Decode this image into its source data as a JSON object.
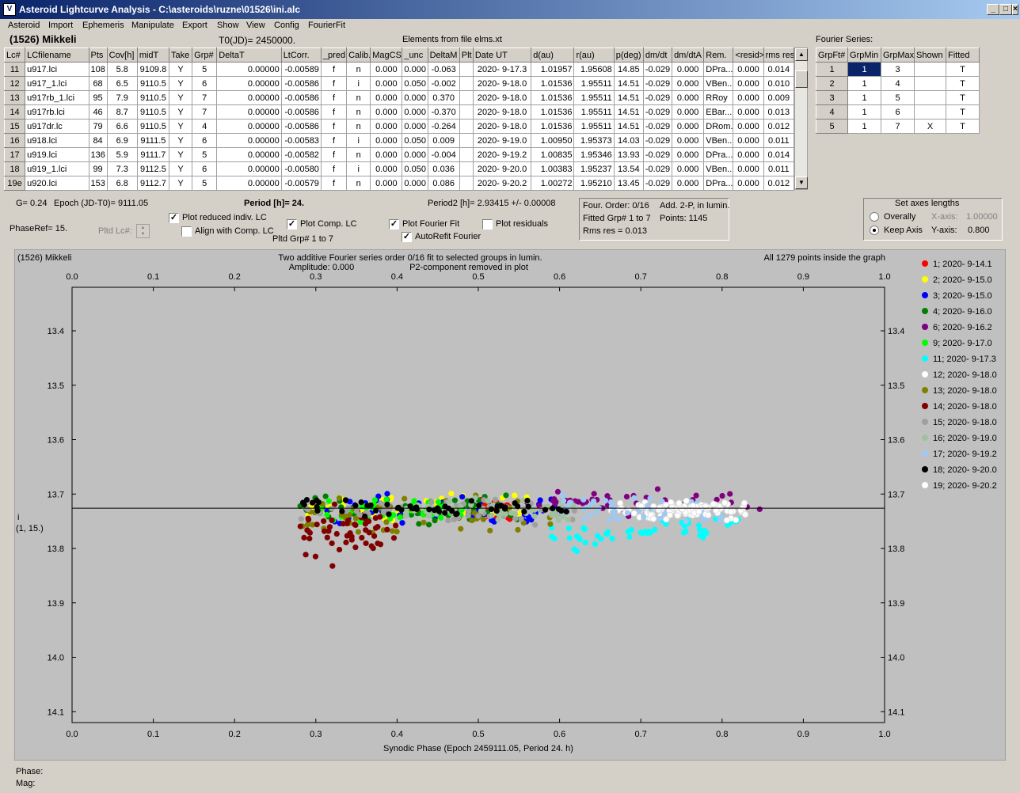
{
  "window": {
    "title": "Asteroid Lightcurve Analysis - C:\\asteroids\\ruzne\\01526\\ini.alc",
    "app_icon": "V"
  },
  "menu": [
    "Asteroid",
    "Import",
    "Ephemeris",
    "Manipulate",
    "Export",
    "Show",
    "View",
    "Config",
    "FourierFit"
  ],
  "asteroid_name": "(1526) Mikkeli",
  "t0": "T0(JD)= 2450000.",
  "elements": "Elements from file elms.xt",
  "lc_table": {
    "headers": [
      "Lc#",
      "LCfilename",
      "Pts",
      "Cov[h]",
      "midT",
      "Take",
      "Grp#",
      "DeltaT",
      "LtCorr.",
      "_pred.",
      "Calib.",
      "MagCS",
      "_unc",
      "DeltaM",
      "Plt",
      "Date UT",
      "d(au)",
      "r(au)",
      "p(deg)",
      "dm/dt",
      "dm/dtA",
      "Rem.",
      "<resid>",
      "rms res"
    ],
    "rows": [
      [
        "11",
        "u917.lci",
        "108",
        "5.8",
        "9109.8",
        "Y",
        "5",
        "0.00000",
        "-0.00589",
        "f",
        "n",
        "0.000",
        "0.000",
        "-0.063",
        "",
        "2020- 9-17.3",
        "1.01957",
        "1.95608",
        "14.85",
        "-0.029",
        "0.000",
        "DPra...",
        "0.000",
        "0.014"
      ],
      [
        "12",
        "u917_1.lci",
        "68",
        "6.5",
        "9110.5",
        "Y",
        "6",
        "0.00000",
        "-0.00586",
        "f",
        "i",
        "0.000",
        "0.050",
        "-0.002",
        "",
        "2020- 9-18.0",
        "1.01536",
        "1.95511",
        "14.51",
        "-0.029",
        "0.000",
        "VBen...",
        "0.000",
        "0.010"
      ],
      [
        "13",
        "u917rb_1.lci",
        "95",
        "7.9",
        "9110.5",
        "Y",
        "7",
        "0.00000",
        "-0.00586",
        "f",
        "n",
        "0.000",
        "0.000",
        "0.370",
        "",
        "2020- 9-18.0",
        "1.01536",
        "1.95511",
        "14.51",
        "-0.029",
        "0.000",
        "RRoy",
        "0.000",
        "0.009"
      ],
      [
        "14",
        "u917rb.lci",
        "46",
        "8.7",
        "9110.5",
        "Y",
        "7",
        "0.00000",
        "-0.00586",
        "f",
        "n",
        "0.000",
        "0.000",
        "-0.370",
        "",
        "2020- 9-18.0",
        "1.01536",
        "1.95511",
        "14.51",
        "-0.029",
        "0.000",
        "EBar...",
        "0.000",
        "0.013"
      ],
      [
        "15",
        "u917dr.lc",
        "79",
        "6.6",
        "9110.5",
        "Y",
        "4",
        "0.00000",
        "-0.00586",
        "f",
        "n",
        "0.000",
        "0.000",
        "-0.264",
        "",
        "2020- 9-18.0",
        "1.01536",
        "1.95511",
        "14.51",
        "-0.029",
        "0.000",
        "DRom...",
        "0.000",
        "0.012"
      ],
      [
        "16",
        "u918.lci",
        "84",
        "6.9",
        "9111.5",
        "Y",
        "6",
        "0.00000",
        "-0.00583",
        "f",
        "i",
        "0.000",
        "0.050",
        "0.009",
        "",
        "2020- 9-19.0",
        "1.00950",
        "1.95373",
        "14.03",
        "-0.029",
        "0.000",
        "VBen...",
        "0.000",
        "0.011"
      ],
      [
        "17",
        "u919.lci",
        "136",
        "5.9",
        "9111.7",
        "Y",
        "5",
        "0.00000",
        "-0.00582",
        "f",
        "n",
        "0.000",
        "0.000",
        "-0.004",
        "",
        "2020- 9-19.2",
        "1.00835",
        "1.95346",
        "13.93",
        "-0.029",
        "0.000",
        "DPra...",
        "0.000",
        "0.014"
      ],
      [
        "18",
        "u919_1.lci",
        "99",
        "7.3",
        "9112.5",
        "Y",
        "6",
        "0.00000",
        "-0.00580",
        "f",
        "i",
        "0.000",
        "0.050",
        "0.036",
        "",
        "2020- 9-20.0",
        "1.00383",
        "1.95237",
        "13.54",
        "-0.029",
        "0.000",
        "VBen...",
        "0.000",
        "0.011"
      ],
      [
        "19e",
        "u920.lci",
        "153",
        "6.8",
        "9112.7",
        "Y",
        "5",
        "0.00000",
        "-0.00579",
        "f",
        "n",
        "0.000",
        "0.000",
        "0.086",
        "",
        "2020- 9-20.2",
        "1.00272",
        "1.95210",
        "13.45",
        "-0.029",
        "0.000",
        "DPra...",
        "0.000",
        "0.012"
      ]
    ]
  },
  "fourier": {
    "title": "Fourier Series:",
    "headers": [
      "GrpFt#",
      "GrpMin",
      "GrpMax",
      "Shown",
      "Fitted"
    ],
    "rows": [
      [
        "1",
        "1",
        "3",
        "",
        "T"
      ],
      [
        "2",
        "1",
        "4",
        "",
        "T"
      ],
      [
        "3",
        "1",
        "5",
        "",
        "T"
      ],
      [
        "4",
        "1",
        "6",
        "",
        "T"
      ],
      [
        "5",
        "1",
        "7",
        "X",
        "T"
      ]
    ]
  },
  "info": {
    "g": "G= 0.24",
    "epoch": "Epoch (JD-T0)= 9111.05",
    "period": "Period [h]= 24.",
    "period2": "Period2 [h]= 2.93415 +/- 0.00008",
    "phaseref": "PhaseRef= 15.",
    "pltd_lc": "Pltd Lc#:",
    "pltd_grp": "Pltd Grp#  1   to   7",
    "four_order": "Four. Order:  0/16",
    "add": "Add. 2-P, in lumin.",
    "fitted_grp": "Fitted Grp# 1 to 7",
    "points": "Points: 1145",
    "rms": "Rms res      = 0.013"
  },
  "checks": [
    {
      "label": "Plot reduced indiv. LC",
      "checked": true
    },
    {
      "label": "Align with Comp. LC",
      "checked": false
    },
    {
      "label": "Plot Comp. LC",
      "checked": true
    },
    {
      "label": "Plot Fourier Fit",
      "checked": true
    },
    {
      "label": "Plot residuals",
      "checked": false
    },
    {
      "label": "AutoRefit Fourier",
      "checked": true
    }
  ],
  "axes_box": {
    "title": "Set axes lengths",
    "overally": "Overally",
    "keep": "Keep Axis",
    "xaxis": "X-axis:",
    "xval": "1.00000",
    "yaxis": "Y-axis:",
    "yval": "0.800"
  },
  "plot": {
    "name": "(1526) Mikkeli",
    "subtitle1": "Two additive Fourier series order 0/16 fit to selected groups in lumin.",
    "subtitle2": "Amplitude: 0.000",
    "subtitle3": "P2-component removed in plot",
    "points_info": "All 1279 points inside the graph",
    "ylabel1": "i",
    "ylabel2": "(1, 15.)",
    "xlabel": "Synodic Phase (Epoch 2459111.05, Period 24. h)"
  },
  "chart_data": {
    "type": "scatter",
    "x_ticks": [
      "0.0",
      "0.1",
      "0.2",
      "0.3",
      "0.4",
      "0.5",
      "0.6",
      "0.7",
      "0.8",
      "0.9",
      "1.0"
    ],
    "y_ticks": [
      "13.4",
      "13.5",
      "13.6",
      "13.7",
      "13.8",
      "13.9",
      "14.0",
      "14.1"
    ],
    "xlim": [
      0,
      1
    ],
    "ylim": [
      13.32,
      14.12
    ],
    "fit_line": 13.726,
    "series": [
      {
        "name": "1; 2020- 9-14.1",
        "color": "#ff0000",
        "xr": [
          0.5,
          0.54
        ],
        "y": 13.73,
        "s": 0.008
      },
      {
        "name": "2; 2020- 9-15.0",
        "color": "#ffff00",
        "xr": [
          0.29,
          0.56
        ],
        "y": 13.73,
        "s": 0.012
      },
      {
        "name": "3; 2020- 9-15.0",
        "color": "#0000ff",
        "xr": [
          0.3,
          0.6
        ],
        "y": 13.73,
        "s": 0.015
      },
      {
        "name": "4; 2020- 9-16.0",
        "color": "#008000",
        "xr": [
          0.28,
          0.55
        ],
        "y": 13.73,
        "s": 0.012
      },
      {
        "name": "6; 2020- 9-16.2",
        "color": "#800080",
        "xr": [
          0.55,
          0.85
        ],
        "y": 13.72,
        "s": 0.012
      },
      {
        "name": "9; 2020- 9-17.0",
        "color": "#00ff00",
        "xr": [
          0.3,
          0.48
        ],
        "y": 13.73,
        "s": 0.01
      },
      {
        "name": "11; 2020- 9-17.3",
        "color": "#00ffff",
        "xr": [
          0.58,
          0.82
        ],
        "y": 13.76,
        "s": 0.03
      },
      {
        "name": "12; 2020- 9-18.0",
        "color": "#ffffff",
        "xr": [
          0.66,
          0.83
        ],
        "y": 13.73,
        "s": 0.008
      },
      {
        "name": "13; 2020- 9-18.0",
        "color": "#808000",
        "xr": [
          0.28,
          0.6
        ],
        "y": 13.74,
        "s": 0.015
      },
      {
        "name": "14; 2020- 9-18.0",
        "color": "#800000",
        "xr": [
          0.28,
          0.4
        ],
        "y": 13.77,
        "s": 0.02
      },
      {
        "name": "15; 2020- 9-18.0",
        "color": "#a0a0a0",
        "xr": [
          0.28,
          0.62
        ],
        "y": 13.73,
        "s": 0.01
      },
      {
        "name": "16; 2020- 9-19.0",
        "color": "#a0c0a0",
        "xr": [
          0.4,
          0.62
        ],
        "y": 13.73,
        "s": 0.008
      },
      {
        "name": "17; 2020- 9-19.2",
        "color": "#a0c8f0",
        "xr": [
          0.6,
          0.8
        ],
        "y": 13.73,
        "s": 0.012
      },
      {
        "name": "18; 2020- 9-20.0",
        "color": "#000000",
        "xr": [
          0.27,
          0.61
        ],
        "y": 13.725,
        "s": 0.008
      },
      {
        "name": "19; 2020- 9-20.2",
        "color": "#ffffff",
        "xr": [
          0.7,
          0.83
        ],
        "y": 13.73,
        "s": 0.01
      }
    ]
  },
  "status": {
    "phase": "Phase:",
    "mag": "Mag:"
  }
}
